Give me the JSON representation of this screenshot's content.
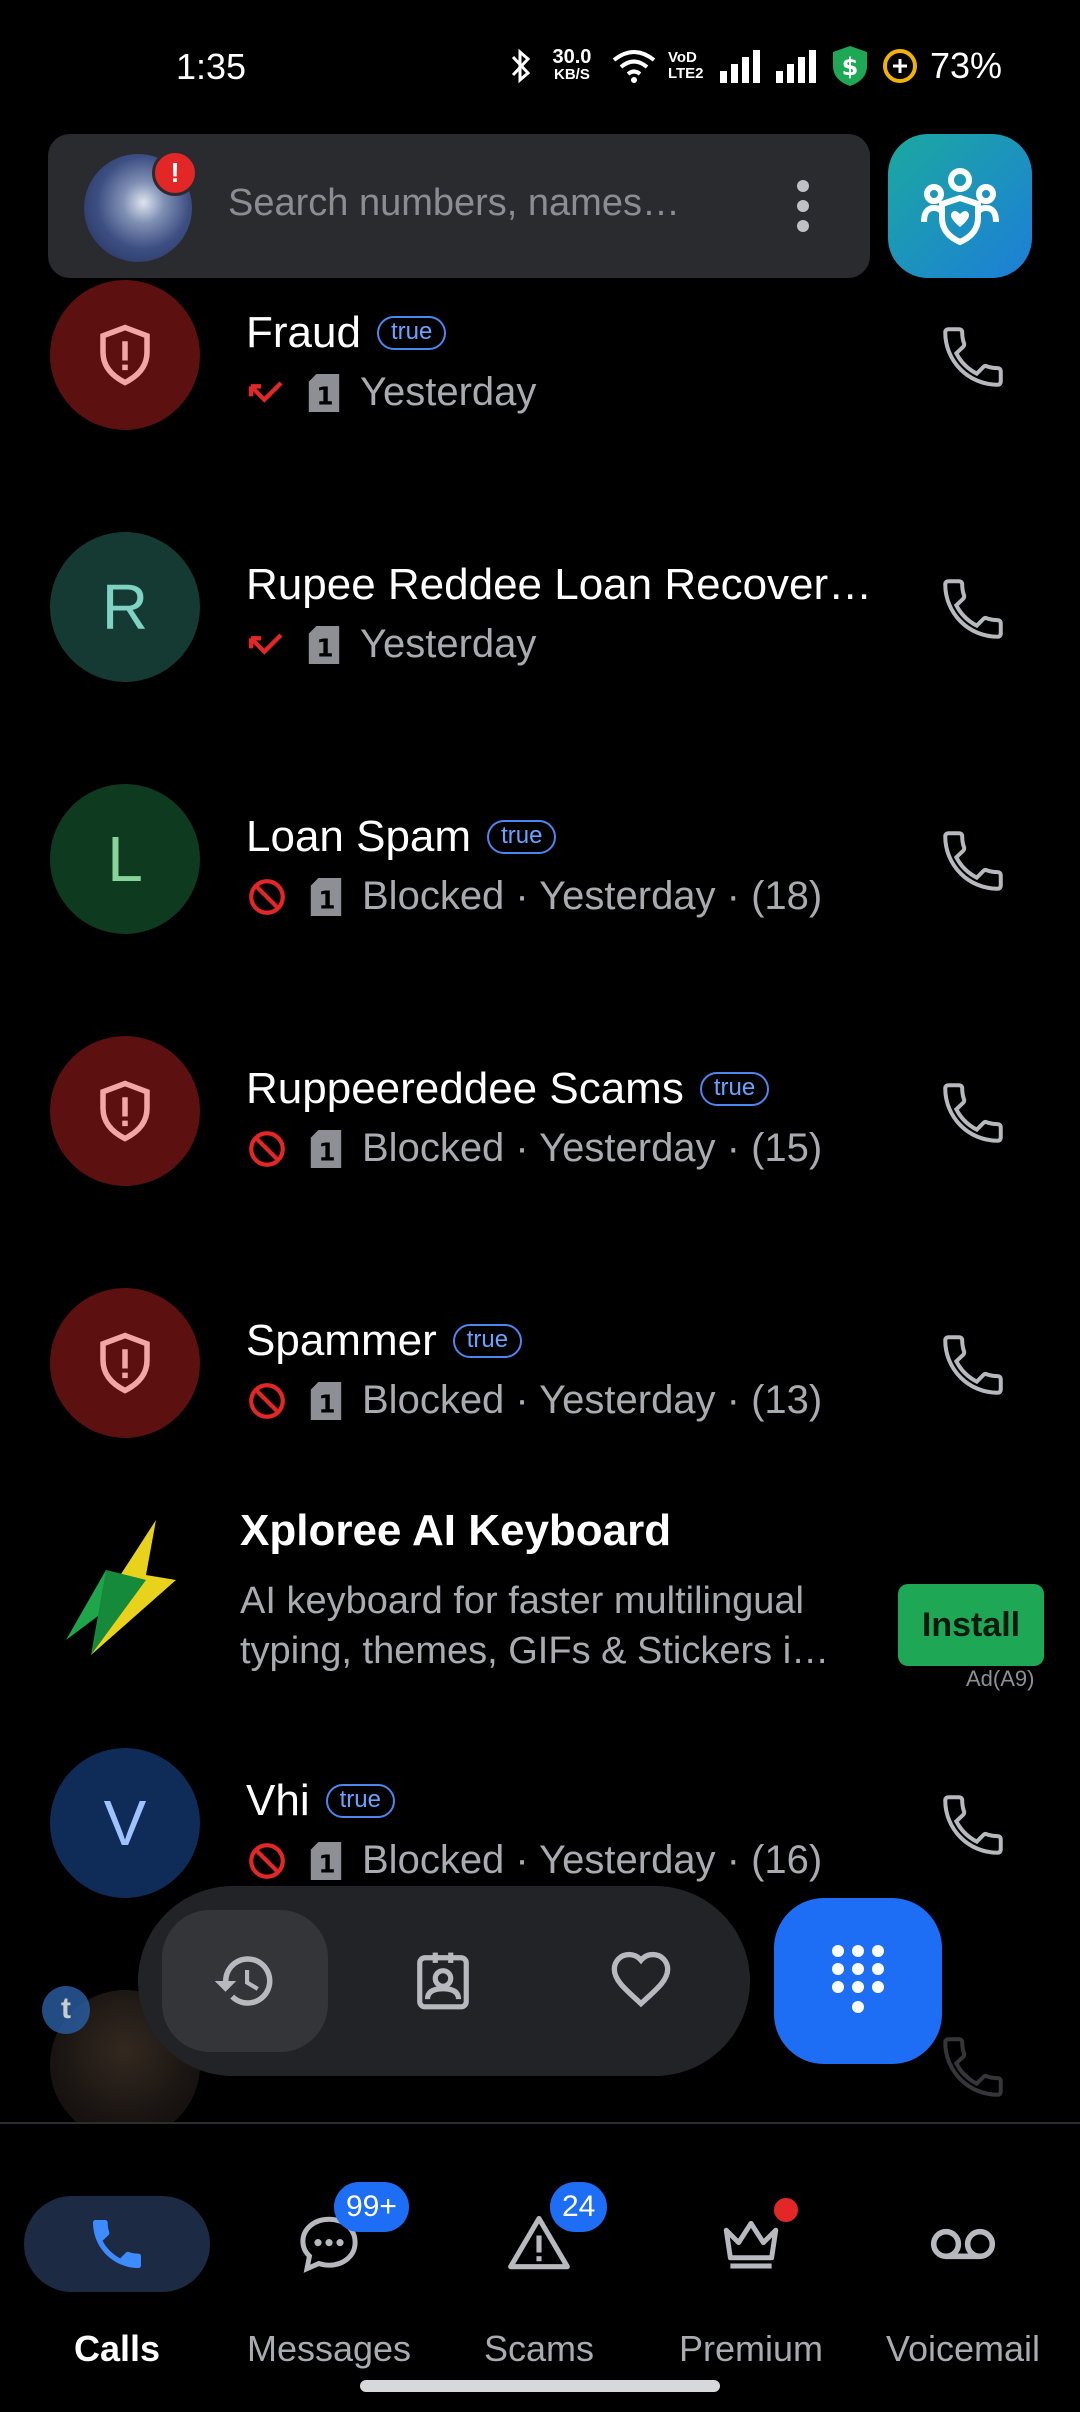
{
  "status_bar": {
    "time": "1:35",
    "net_speed_value": "30.0",
    "net_speed_unit": "KB/S",
    "volte_line1": "VoD",
    "volte_line2": "LTE2",
    "battery_percent": "73%"
  },
  "search": {
    "placeholder": "Search numbers, names…",
    "avatar_alert": "!"
  },
  "calls": [
    {
      "name": "Fraud",
      "badge": "true",
      "detail": "Yesterday",
      "status": "missed",
      "avatar": "shield"
    },
    {
      "name": "Rupee Reddee Loan Recover…",
      "badge": "",
      "detail": "Yesterday",
      "status": "missed",
      "avatar": "R"
    },
    {
      "name": "Loan Spam",
      "badge": "true",
      "detail": "Blocked · Yesterday · (18)",
      "status": "blocked",
      "avatar": "L"
    },
    {
      "name": "Ruppeereddee Scams",
      "badge": "true",
      "detail": "Blocked · Yesterday · (15)",
      "status": "blocked",
      "avatar": "shield"
    },
    {
      "name": "Spammer",
      "badge": "true",
      "detail": "Blocked · Yesterday · (13)",
      "status": "blocked",
      "avatar": "shield"
    },
    {
      "name": "Vhi",
      "badge": "true",
      "detail": "Blocked · Yesterday · (16)",
      "status": "blocked",
      "avatar": "V"
    }
  ],
  "ad": {
    "title": "Xploree AI Keyboard",
    "desc_line1": "AI keyboard for faster multilingual",
    "desc_line2": "typing, themes, GIFs & Stickers i…",
    "button": "Install",
    "tag": "Ad(A9)"
  },
  "ghost_row": {
    "badge_letter": "t"
  },
  "bottom_nav": {
    "items": [
      {
        "label": "Calls",
        "icon": "phone-icon"
      },
      {
        "label": "Messages",
        "icon": "chat-icon",
        "badge": "99+"
      },
      {
        "label": "Scams",
        "icon": "warning-icon",
        "badge": "24"
      },
      {
        "label": "Premium",
        "icon": "crown-icon"
      },
      {
        "label": "Voicemail",
        "icon": "voicemail-icon"
      }
    ]
  },
  "colors": {
    "accent": "#1e6ef5",
    "missed_red": "#e32727",
    "spam_avatar_bg": "#5c1010",
    "install_green": "#1ea855"
  }
}
